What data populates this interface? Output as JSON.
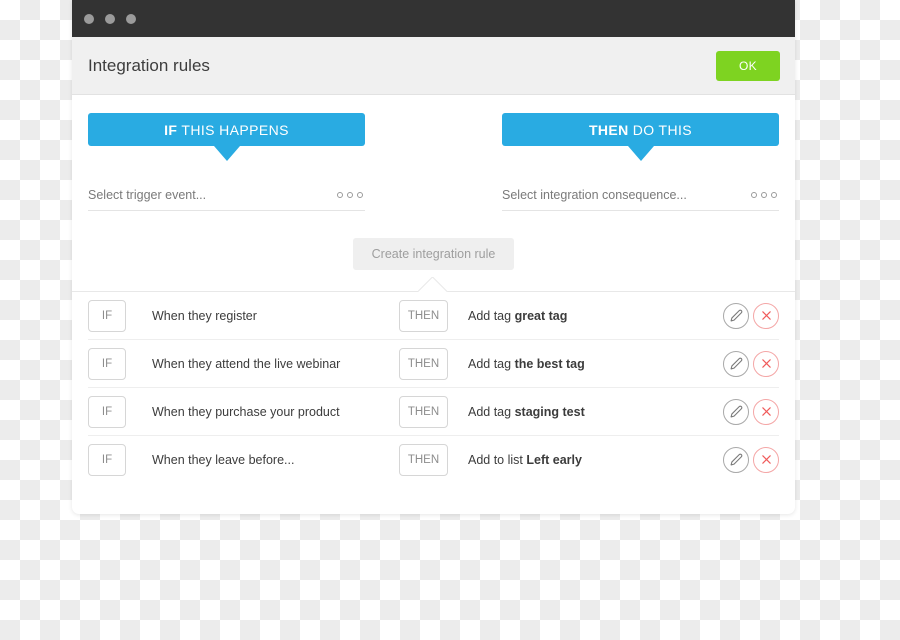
{
  "window": {
    "titlebar": {
      "dots": [
        "dot-1",
        "dot-2",
        "dot-3"
      ]
    },
    "header": {
      "title": "Integration rules",
      "ok_label": "OK",
      "ok_color": "#7ed321"
    }
  },
  "builder": {
    "accent_color": "#29abe2",
    "if_column": {
      "banner_strong": "IF",
      "banner_rest": "THIS HAPPENS",
      "select_placeholder": "Select trigger event...",
      "menu_icon": "ellipsis-icon"
    },
    "then_column": {
      "banner_strong": "THEN",
      "banner_rest": "DO THIS",
      "select_placeholder": "Select integration consequence...",
      "menu_icon": "ellipsis-icon"
    },
    "create_label": "Create integration rule"
  },
  "rules": [
    {
      "if_badge": "IF",
      "trigger": "When they register",
      "then_badge": "THEN",
      "action_prefix": "Add tag",
      "action_value": "great tag",
      "edit_icon": "pencil-icon",
      "delete_icon": "close-circle-icon"
    },
    {
      "if_badge": "IF",
      "trigger": "When they attend the live webinar",
      "then_badge": "THEN",
      "action_prefix": "Add tag",
      "action_value": "the best tag",
      "edit_icon": "pencil-icon",
      "delete_icon": "close-circle-icon"
    },
    {
      "if_badge": "IF",
      "trigger": "When they purchase your product",
      "then_badge": "THEN",
      "action_prefix": "Add tag",
      "action_value": "staging test",
      "edit_icon": "pencil-icon",
      "delete_icon": "close-circle-icon"
    },
    {
      "if_badge": "IF",
      "trigger": "When they leave before...",
      "then_badge": "THEN",
      "action_prefix": "Add to list",
      "action_value": "Left early",
      "edit_icon": "pencil-icon",
      "delete_icon": "close-circle-icon"
    }
  ]
}
